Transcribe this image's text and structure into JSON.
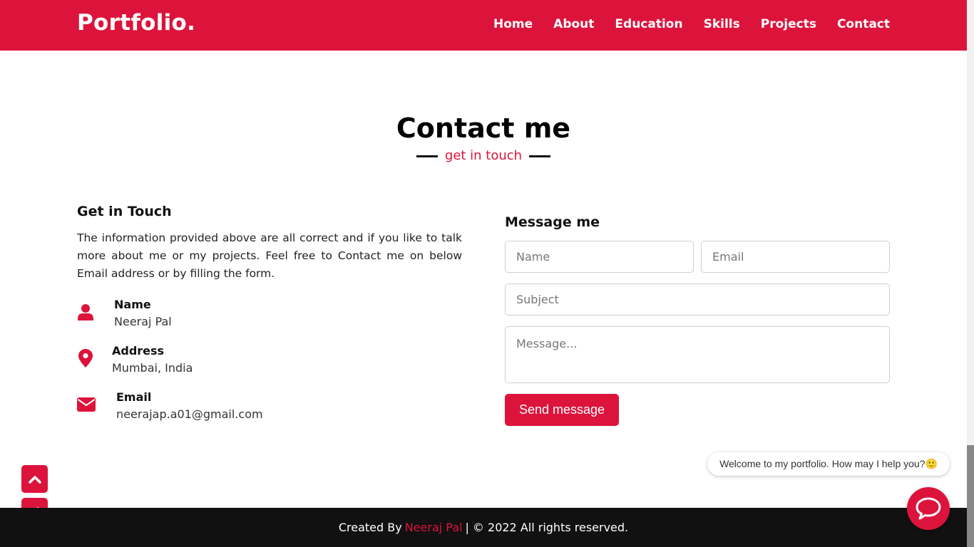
{
  "navbar": {
    "logo": "Portfolio.",
    "links": [
      "Home",
      "About",
      "Education",
      "Skills",
      "Projects",
      "Contact"
    ]
  },
  "section": {
    "title": "Contact me",
    "subtitle": "get in touch"
  },
  "left": {
    "heading": "Get in Touch",
    "text": "The information provided above are all correct and if you like to talk more about me or my projects. Feel free to Contact me on below Email address or by filling the form.",
    "info": [
      {
        "icon": "user-icon",
        "title": "Name",
        "value": "Neeraj Pal"
      },
      {
        "icon": "map-marker-icon",
        "title": "Address",
        "value": "Mumbai, India"
      },
      {
        "icon": "envelope-icon",
        "title": "Email",
        "value": "neerajap.a01@gmail.com"
      }
    ]
  },
  "form": {
    "heading": "Message me",
    "name_placeholder": "Name",
    "email_placeholder": "Email",
    "subject_placeholder": "Subject",
    "message_placeholder": "Message...",
    "send_label": "Send message"
  },
  "chat": {
    "welcome": "Welcome to my portfolio. How may I help you?🙂"
  },
  "footer": {
    "created_by": "Created By",
    "author": "Neeraj Pal",
    "rights": "| © 2022 All rights reserved."
  },
  "colors": {
    "accent": "#dc143c",
    "footer_bg": "#111111"
  }
}
